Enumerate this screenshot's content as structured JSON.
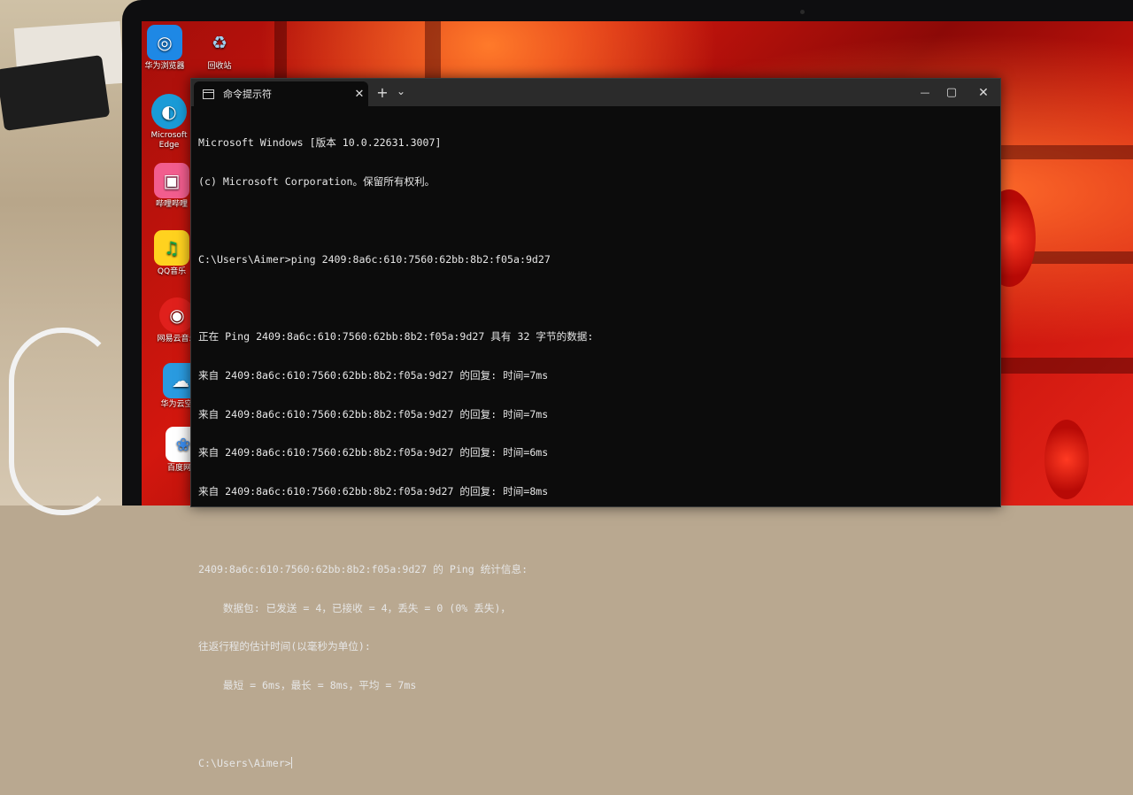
{
  "desktop": {
    "icons": [
      {
        "label": "华为浏览器",
        "icon": "huawei-browser-icon",
        "glyph": "◎",
        "color": "#1e88e5"
      },
      {
        "label": "回收站",
        "icon": "recycle-bin-icon",
        "glyph": "♻",
        "color": "#4fa3d9"
      },
      {
        "label": "Microsoft Edge",
        "icon": "edge-icon",
        "glyph": "◐",
        "color": "#1a9bd7"
      },
      {
        "label": "哔哩哔哩",
        "icon": "bilibili-icon",
        "glyph": "▣",
        "color": "#f25d8e"
      },
      {
        "label": "QQ音乐",
        "icon": "qq-music-icon",
        "glyph": "♫",
        "color": "#ffd21f"
      },
      {
        "label": "网易云音乐",
        "icon": "netease-music-icon",
        "glyph": "◉",
        "color": "#e0201c"
      },
      {
        "label": "华为云空间",
        "icon": "huawei-cloud-icon",
        "glyph": "☁",
        "color": "#2a9be0"
      },
      {
        "label": "百度网盘",
        "icon": "baidu-netdisk-icon",
        "glyph": "❀",
        "color": "#3b8ef2"
      }
    ]
  },
  "window": {
    "tab_title": "命令提示符",
    "tab_close": "✕",
    "new_tab": "+",
    "dropdown": "⌄",
    "minimize": "—",
    "maximize": "▢",
    "close": "✕"
  },
  "console": {
    "lines": [
      "Microsoft Windows [版本 10.0.22631.3007]",
      "(c) Microsoft Corporation。保留所有权利。",
      "",
      "C:\\Users\\Aimer>ping 2409:8a6c:610:7560:62bb:8b2:f05a:9d27",
      "",
      "正在 Ping 2409:8a6c:610:7560:62bb:8b2:f05a:9d27 具有 32 字节的数据:",
      "来自 2409:8a6c:610:7560:62bb:8b2:f05a:9d27 的回复: 时间=7ms",
      "来自 2409:8a6c:610:7560:62bb:8b2:f05a:9d27 的回复: 时间=7ms",
      "来自 2409:8a6c:610:7560:62bb:8b2:f05a:9d27 的回复: 时间=6ms",
      "来自 2409:8a6c:610:7560:62bb:8b2:f05a:9d27 的回复: 时间=8ms",
      "",
      "2409:8a6c:610:7560:62bb:8b2:f05a:9d27 的 Ping 统计信息:",
      "    数据包: 已发送 = 4，已接收 = 4，丢失 = 0 (0% 丢失)，",
      "往返行程的估计时间(以毫秒为单位):",
      "    最短 = 6ms，最长 = 8ms，平均 = 7ms",
      ""
    ],
    "prompt": "C:\\Users\\Aimer>"
  }
}
